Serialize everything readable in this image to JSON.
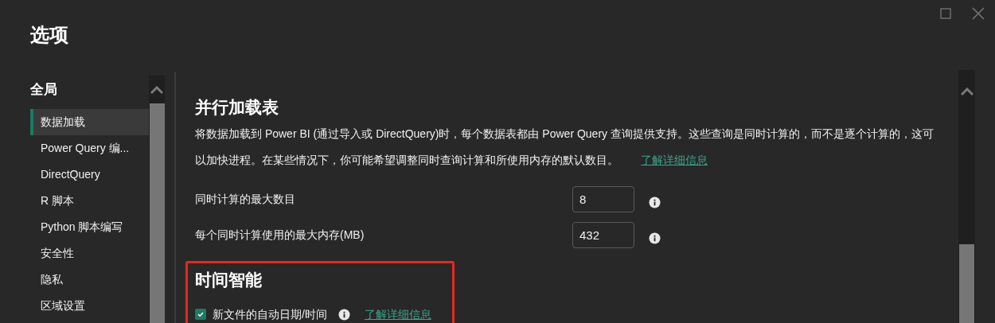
{
  "window": {
    "title": "选项"
  },
  "sidebar": {
    "heading": "全局",
    "items": [
      {
        "label": "数据加载",
        "selected": true
      },
      {
        "label": "Power Query 编...",
        "selected": false
      },
      {
        "label": "DirectQuery",
        "selected": false
      },
      {
        "label": "R 脚本",
        "selected": false
      },
      {
        "label": "Python 脚本编写",
        "selected": false
      },
      {
        "label": "安全性",
        "selected": false
      },
      {
        "label": "隐私",
        "selected": false
      },
      {
        "label": "区域设置",
        "selected": false
      }
    ]
  },
  "sections": [
    {
      "title": "并行加载表",
      "description": "将数据加载到 Power BI (通过导入或 DirectQuery)时，每个数据表都由 Power Query 查询提供支持。这些查询是同时计算的，而不是逐个计算的，这可以加快进程。在某些情况下，你可能希望调整同时查询计算和所使用内存的默认数目。",
      "link": "了解详细信息",
      "highlighted": false,
      "settings": [
        {
          "kind": "number",
          "label": "同时计算的最大数目",
          "value": "8"
        },
        {
          "kind": "number",
          "label": "每个同时计算使用的最大内存(MB)",
          "value": "432"
        }
      ]
    },
    {
      "title": "时间智能",
      "highlighted": true,
      "settings": [
        {
          "kind": "checkbox",
          "label": "新文件的自动日期/时间",
          "checked": true,
          "link": "了解详细信息"
        }
      ]
    }
  ]
}
